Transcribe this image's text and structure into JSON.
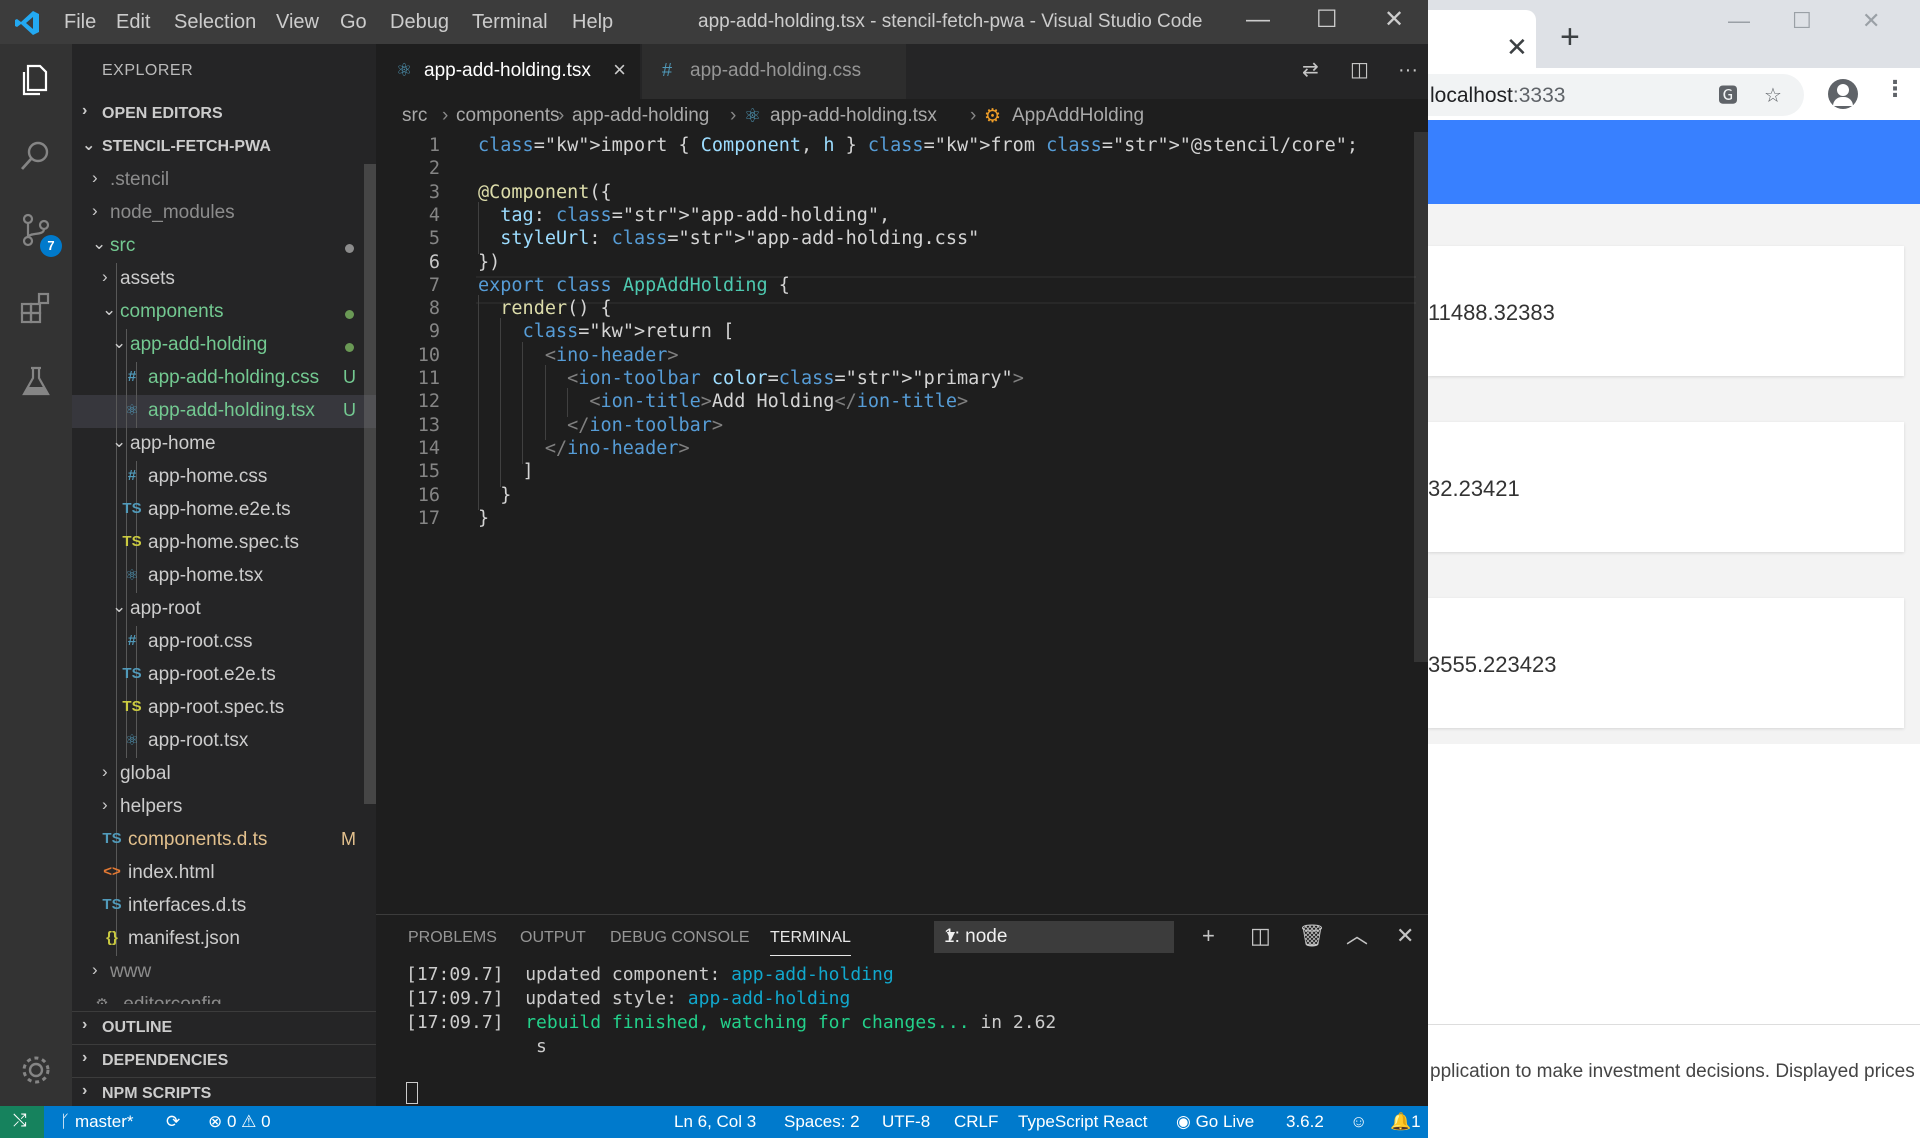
{
  "vscode": {
    "menu": [
      "File",
      "Edit",
      "Selection",
      "View",
      "Go",
      "Debug",
      "Terminal",
      "Help"
    ],
    "window_title": "app-add-holding.tsx - stencil-fetch-pwa - Visual Studio Code",
    "source_control_badge": "7",
    "explorer_title": "EXPLORER",
    "sections": {
      "open_editors": "OPEN EDITORS",
      "project": "STENCIL-FETCH-PWA",
      "outline": "OUTLINE",
      "dependencies": "DEPENDENCIES",
      "npm_scripts": "NPM SCRIPTS"
    },
    "tree": [
      {
        "name": ".stencil",
        "type": "folder",
        "depth": 1,
        "open": false,
        "dim": true
      },
      {
        "name": "node_modules",
        "type": "folder",
        "depth": 1,
        "open": false,
        "dim": true
      },
      {
        "name": "src",
        "type": "folder",
        "depth": 1,
        "open": true,
        "status": "dot-grey",
        "color": "green"
      },
      {
        "name": "assets",
        "type": "folder",
        "depth": 2,
        "open": false
      },
      {
        "name": "components",
        "type": "folder",
        "depth": 2,
        "open": true,
        "status": "dot",
        "color": "green"
      },
      {
        "name": "app-add-holding",
        "type": "folder",
        "depth": 3,
        "open": true,
        "status": "dot",
        "color": "green"
      },
      {
        "name": "app-add-holding.css",
        "type": "css",
        "depth": 4,
        "status": "U",
        "color": "green"
      },
      {
        "name": "app-add-holding.tsx",
        "type": "react",
        "depth": 4,
        "status": "U",
        "color": "green",
        "selected": true
      },
      {
        "name": "app-home",
        "type": "folder",
        "depth": 3,
        "open": true
      },
      {
        "name": "app-home.css",
        "type": "css",
        "depth": 4
      },
      {
        "name": "app-home.e2e.ts",
        "type": "ts",
        "depth": 4
      },
      {
        "name": "app-home.spec.ts",
        "type": "ts-spec",
        "depth": 4
      },
      {
        "name": "app-home.tsx",
        "type": "react",
        "depth": 4
      },
      {
        "name": "app-root",
        "type": "folder",
        "depth": 3,
        "open": true
      },
      {
        "name": "app-root.css",
        "type": "css",
        "depth": 4
      },
      {
        "name": "app-root.e2e.ts",
        "type": "ts",
        "depth": 4
      },
      {
        "name": "app-root.spec.ts",
        "type": "ts-spec",
        "depth": 4
      },
      {
        "name": "app-root.tsx",
        "type": "react",
        "depth": 4
      },
      {
        "name": "global",
        "type": "folder",
        "depth": 2,
        "open": false
      },
      {
        "name": "helpers",
        "type": "folder",
        "depth": 2,
        "open": false
      },
      {
        "name": "components.d.ts",
        "type": "ts",
        "depth": 2,
        "status": "M",
        "color": "yellow"
      },
      {
        "name": "index.html",
        "type": "html",
        "depth": 2
      },
      {
        "name": "interfaces.d.ts",
        "type": "ts",
        "depth": 2
      },
      {
        "name": "manifest.json",
        "type": "json",
        "depth": 2
      },
      {
        "name": "www",
        "type": "folder",
        "depth": 1,
        "open": false,
        "dim": true
      },
      {
        "name": ".editorconfig",
        "type": "config",
        "depth": 1,
        "dim": true
      }
    ],
    "tabs": [
      {
        "label": "app-add-holding.tsx",
        "active": true
      },
      {
        "label": "app-add-holding.css",
        "active": false
      }
    ],
    "breadcrumbs": [
      "src",
      "components",
      "app-add-holding",
      "app-add-holding.tsx",
      "AppAddHolding"
    ],
    "code_lines": [
      "import { Component, h } from \"@stencil/core\";",
      "",
      "@Component({",
      "  tag: \"app-add-holding\",",
      "  styleUrl: \"app-add-holding.css\"",
      "})",
      "export class AppAddHolding {",
      "  render() {",
      "    return [",
      "      <ino-header>",
      "        <ion-toolbar color=\"primary\">",
      "          <ion-title>Add Holding</ion-title>",
      "        </ion-toolbar>",
      "      </ino-header>",
      "    ]",
      "  }",
      "}"
    ],
    "current_line": 6,
    "panel_tabs": [
      "PROBLEMS",
      "OUTPUT",
      "DEBUG CONSOLE",
      "TERMINAL"
    ],
    "active_panel_tab": "TERMINAL",
    "terminal_select": "1: node",
    "terminal_lines": [
      {
        "time": "[17:09.7]",
        "text": "updated component: ",
        "hl": "app-add-holding",
        "hl_color": "cyan"
      },
      {
        "time": "[17:09.7]",
        "text": "updated style: ",
        "hl": "app-add-holding",
        "hl_color": "cyan"
      },
      {
        "time": "[17:09.7]",
        "text": "",
        "hl": "rebuild finished, watching for changes...",
        "hl_color": "green",
        "tail": " in 2.62"
      },
      {
        "time": "",
        "text": "s",
        "hl": "",
        "hl_color": ""
      }
    ],
    "status": {
      "branch": "master*",
      "errors": "0",
      "warnings": "0",
      "position": "Ln 6, Col 3",
      "spaces": "Spaces: 2",
      "encoding": "UTF-8",
      "eol": "CRLF",
      "language": "TypeScript React",
      "go_live": "Go Live",
      "ts_version": "3.6.2",
      "notifications": "1"
    }
  },
  "browser": {
    "url_host": "localhost",
    "url_port": ":3333",
    "cards": [
      "11488.32383",
      "32.23421",
      "3555.223423"
    ],
    "footer_text": "pplication to make investment decisions. Displayed prices",
    "header_color": "#3880ff"
  },
  "colors": {
    "statusbar": "#007acc",
    "accent_green": "#73c991",
    "accent_yellow": "#e2c08d"
  }
}
